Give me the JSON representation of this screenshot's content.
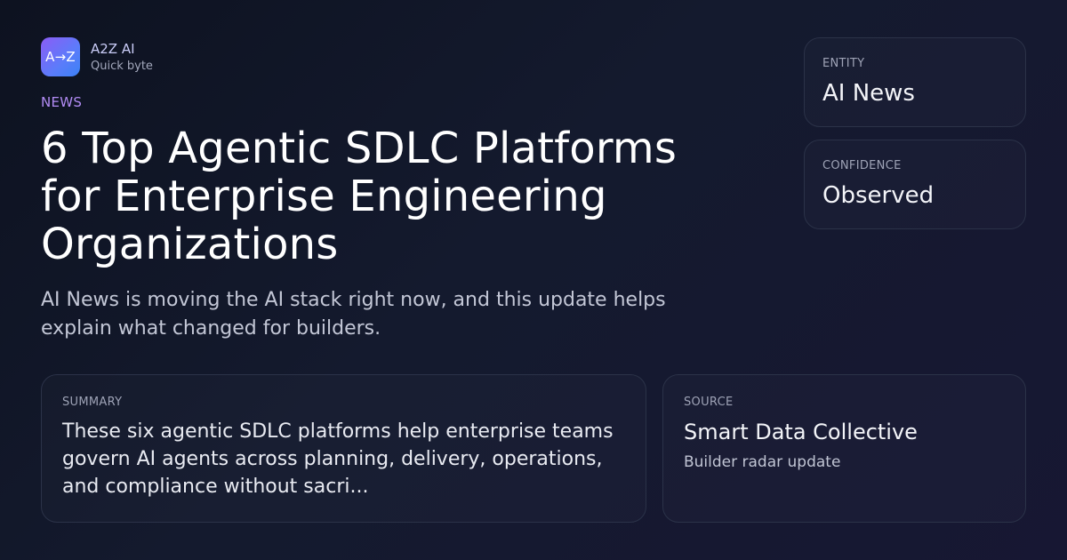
{
  "brand": {
    "logo_text": "A→Z",
    "name": "A2Z AI",
    "subtitle": "Quick byte"
  },
  "article": {
    "category": "NEWS",
    "title": "6 Top Agentic SDLC Platforms for Enterprise Engineering Organizations",
    "lede": "AI News is moving the AI stack right now, and this update helps explain what changed for builders."
  },
  "entity": {
    "label": "ENTITY",
    "value": "AI News"
  },
  "confidence": {
    "label": "CONFIDENCE",
    "value": "Observed"
  },
  "summary": {
    "label": "SUMMARY",
    "text": "These six agentic SDLC platforms help enterprise teams govern AI agents across planning, delivery, operations, and compliance without sacri..."
  },
  "source": {
    "label": "SOURCE",
    "name": "Smart Data Collective",
    "subtitle": "Builder radar update"
  },
  "colors": {
    "accent": "#b28cf5",
    "logo_gradient_start": "#8b5cf6",
    "logo_gradient_end": "#3b82f6",
    "background": "#141a2e"
  }
}
